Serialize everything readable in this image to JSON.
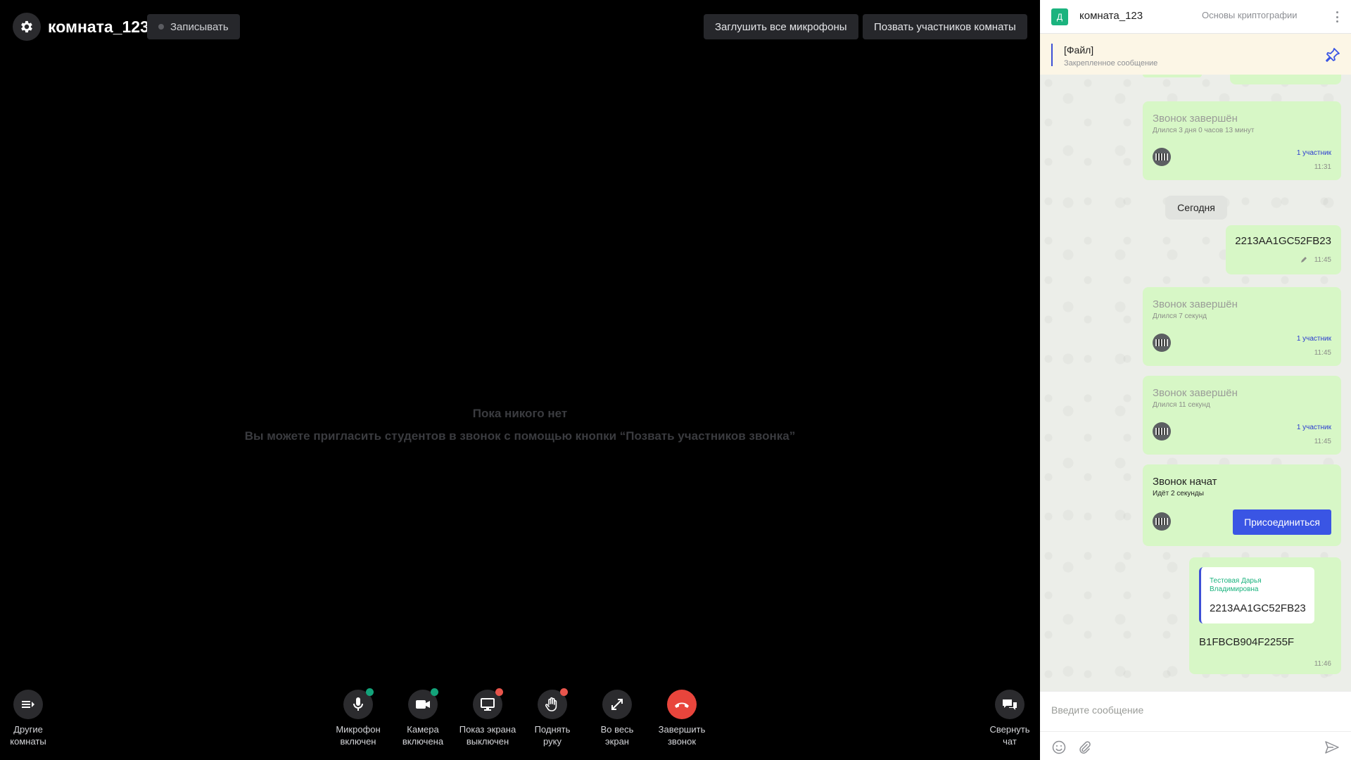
{
  "header": {
    "room_title": "комната_123",
    "record_label": "Записывать",
    "mute_all_label": "Заглушить все микрофоны",
    "invite_label": "Позвать участников комнаты"
  },
  "empty_state": {
    "title": "Пока никого нет",
    "text": "Вы можете пригласить студентов в звонок с помощью кнопки “Позвать участников звонка”"
  },
  "controls": {
    "other_rooms": {
      "line1": "Другие",
      "line2": "комнаты"
    },
    "mic": {
      "line1": "Микрофон",
      "line2": "включен",
      "status": "on"
    },
    "camera": {
      "line1": "Камера",
      "line2": "включена",
      "status": "on"
    },
    "screen": {
      "line1": "Показ экрана",
      "line2": "выключен",
      "status": "off"
    },
    "hand": {
      "line1": "Поднять",
      "line2": "руку",
      "status": "off"
    },
    "fullscreen": {
      "line1": "Во весь",
      "line2": "экран"
    },
    "end_call": {
      "line1": "Завершить",
      "line2": "звонок"
    },
    "collapse_chat": {
      "line1": "Свернуть",
      "line2": "чат"
    }
  },
  "colors": {
    "accent": "#3a55e4",
    "end_call": "#e8453c",
    "status_on": "#13a37a",
    "status_off": "#e8554c",
    "bubble": "#d7f7c6"
  },
  "chat": {
    "avatar_letter": "Д",
    "name": "комната_123",
    "course": "Основы криптографии",
    "pinned": {
      "title": "[Файл]",
      "subtitle": "Закрепленное сообщение"
    },
    "messages": [
      {
        "type": "call_ended",
        "title": "Звонок завершён",
        "duration": "Длился 3 дня 0 часов 13 минут",
        "participants": "1 участник",
        "time": "11:31"
      },
      {
        "type": "date",
        "label": "Сегодня"
      },
      {
        "type": "text",
        "text": "2213AA1GC52FB23",
        "edited": true,
        "time": "11:45"
      },
      {
        "type": "call_ended",
        "title": "Звонок завершён",
        "duration": "Длился 7 секунд",
        "participants": "1 участник",
        "time": "11:45"
      },
      {
        "type": "call_ended",
        "title": "Звонок завершён",
        "duration": "Длился 11 секунд",
        "participants": "1 участник",
        "time": "11:45"
      },
      {
        "type": "call_started",
        "title": "Звонок начат",
        "duration": "Идёт 2 секунды",
        "join_label": "Присоединиться"
      },
      {
        "type": "reply",
        "quote_author": "Тестовая Дарья Владимировна",
        "quote_text": "2213AA1GC52FB23",
        "text": "B1FBCB904F2255F",
        "time": "11:46"
      }
    ],
    "composer_placeholder": "Введите сообщение"
  }
}
